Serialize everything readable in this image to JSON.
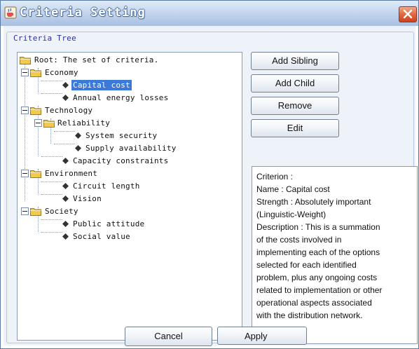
{
  "window": {
    "title": "Criteria Setting",
    "title_icon": "java-cup-icon",
    "close_icon": "close-icon"
  },
  "group": {
    "label": "Criteria Tree"
  },
  "tree": {
    "root": "Root: The set of criteria.",
    "nodes": [
      {
        "label": "Economy",
        "type": "folder",
        "level": 1
      },
      {
        "label": "Capital cost",
        "type": "leaf",
        "level": 2,
        "selected": true
      },
      {
        "label": "Annual energy losses",
        "type": "leaf",
        "level": 2
      },
      {
        "label": "Technology",
        "type": "folder",
        "level": 1
      },
      {
        "label": "Reliability",
        "type": "folder",
        "level": 2
      },
      {
        "label": "System security",
        "type": "leaf",
        "level": 3
      },
      {
        "label": "Supply availability",
        "type": "leaf",
        "level": 3
      },
      {
        "label": "Capacity constraints",
        "type": "leaf",
        "level": 2
      },
      {
        "label": "Environment",
        "type": "folder",
        "level": 1
      },
      {
        "label": "Circuit length",
        "type": "leaf",
        "level": 2
      },
      {
        "label": "Vision",
        "type": "leaf",
        "level": 2
      },
      {
        "label": "Society",
        "type": "folder",
        "level": 1
      },
      {
        "label": "Public attitude",
        "type": "leaf",
        "level": 2
      },
      {
        "label": "Social value",
        "type": "leaf",
        "level": 2
      }
    ]
  },
  "actions": {
    "add_sibling": "Add Sibling",
    "add_child": "Add Child",
    "remove": "Remove",
    "edit": "Edit"
  },
  "detail": {
    "lines": [
      "Criterion :",
      "Name : Capital cost",
      "Strength : Absolutely important",
      "(Linguistic-Weight)",
      "Description : This is a summation",
      "of the costs involved in",
      "implementing each of the options",
      "selected for each identified",
      "problem, plus any ongoing costs",
      "related to implementation or other",
      "operational aspects associated",
      "with the distribution network."
    ]
  },
  "footer": {
    "cancel": "Cancel",
    "apply": "Apply"
  },
  "colors": {
    "selection": "#3d7ad8",
    "folder": "#f2c94c",
    "close_button": "#e2683f"
  }
}
